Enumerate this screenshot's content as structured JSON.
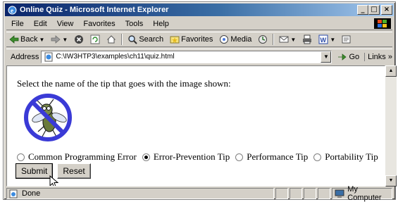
{
  "window": {
    "title": "Online Quiz - Microsoft Internet Explorer",
    "controls": {
      "minimize": "_",
      "maximize": "□",
      "close": "×"
    }
  },
  "menu": [
    "File",
    "Edit",
    "View",
    "Favorites",
    "Tools",
    "Help"
  ],
  "toolbar": {
    "back": "Back",
    "search": "Search",
    "favorites": "Favorites",
    "media": "Media"
  },
  "address": {
    "label": "Address",
    "url": "C:\\IW3HTP3\\examples\\ch11\\quiz.html",
    "go": "Go",
    "links": "Links"
  },
  "page": {
    "prompt": "Select the name of the tip that goes with the image shown:",
    "options": [
      {
        "label": "Common Programming Error",
        "checked": false
      },
      {
        "label": "Error-Prevention Tip",
        "checked": true
      },
      {
        "label": "Performance Tip",
        "checked": false
      },
      {
        "label": "Portability Tip",
        "checked": false
      }
    ],
    "submit": "Submit",
    "reset": "Reset"
  },
  "status": {
    "text": "Done",
    "zone": "My Computer"
  },
  "colors": {
    "title_bar": "#0a246a",
    "chrome": "#d4d0c8",
    "no_sign": "#3a3ad6"
  },
  "icons": {
    "title": "ie-icon",
    "back": "back-arrow-icon",
    "forward": "forward-arrow-icon",
    "stop": "stop-icon",
    "refresh": "refresh-icon",
    "home": "home-icon",
    "search": "search-icon",
    "favorites": "favorites-icon",
    "media": "media-icon",
    "history": "history-icon",
    "mail": "mail-icon",
    "print": "print-icon",
    "edit": "word-edit-icon",
    "discuss": "discuss-icon"
  }
}
